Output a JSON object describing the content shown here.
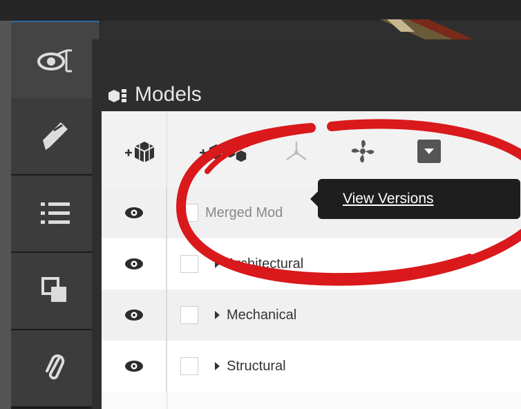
{
  "panel": {
    "title": "Models"
  },
  "toolbar": {
    "buttons": [
      {
        "icon": "add-model-icon"
      },
      {
        "icon": "add-models-group-icon"
      },
      {
        "icon": "explode-icon"
      },
      {
        "icon": "fan-icon"
      },
      {
        "icon": "dropdown-icon"
      }
    ]
  },
  "rows": [
    {
      "label": "Merged Mod",
      "expandable": false
    },
    {
      "label": "Architectural",
      "expandable": true
    },
    {
      "label": "Mechanical",
      "expandable": true
    },
    {
      "label": "Structural",
      "expandable": true
    }
  ],
  "tooltip": {
    "label": "View Versions"
  },
  "colors": {
    "annotation": "#d9191b",
    "sidebar": "#3c3c3c",
    "panel_header": "#2e2e2e",
    "tooltip": "#1e1e1e"
  }
}
